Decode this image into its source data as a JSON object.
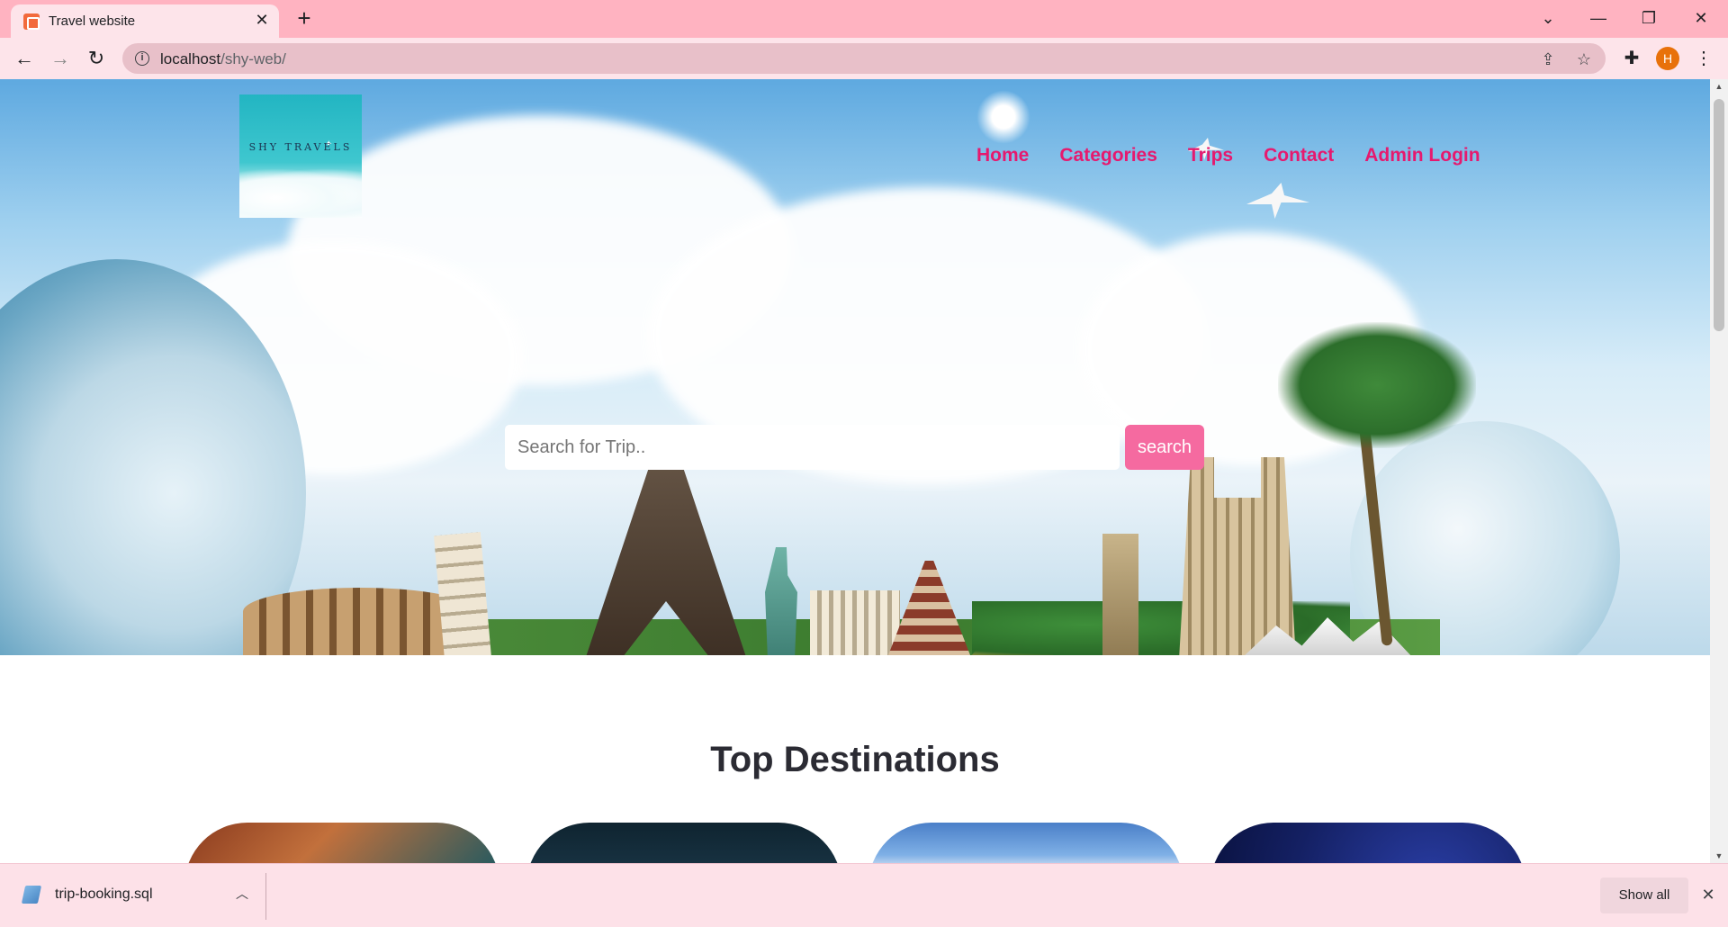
{
  "browser": {
    "tab_title": "Travel website",
    "tab_close": "✕",
    "new_tab": "+",
    "url_host": "localhost",
    "url_path": "/shy-web/",
    "avatar_letter": "H",
    "icons": {
      "back": "arrow-left-icon",
      "forward": "arrow-right-icon",
      "reload": "reload-icon",
      "info": "info-icon",
      "share": "share-icon",
      "bookmark": "star-icon",
      "extensions": "puzzle-icon",
      "menu": "kebab-menu-icon"
    }
  },
  "site": {
    "logo_text": "SHY TRAVELS",
    "nav": [
      "Home",
      "Categories",
      "Trips",
      "Contact",
      "Admin Login"
    ],
    "search": {
      "placeholder": "Search for Trip..",
      "button": "search"
    },
    "section_title": "Top Destinations"
  },
  "download_bar": {
    "file_name": "trip-booking.sql",
    "show_all": "Show all"
  },
  "colors": {
    "tabstrip": "#ffb3c1",
    "toolbar": "#fde4ea",
    "nav_link": "#e6196e",
    "search_button": "#f56aa0",
    "avatar": "#e8710a"
  }
}
